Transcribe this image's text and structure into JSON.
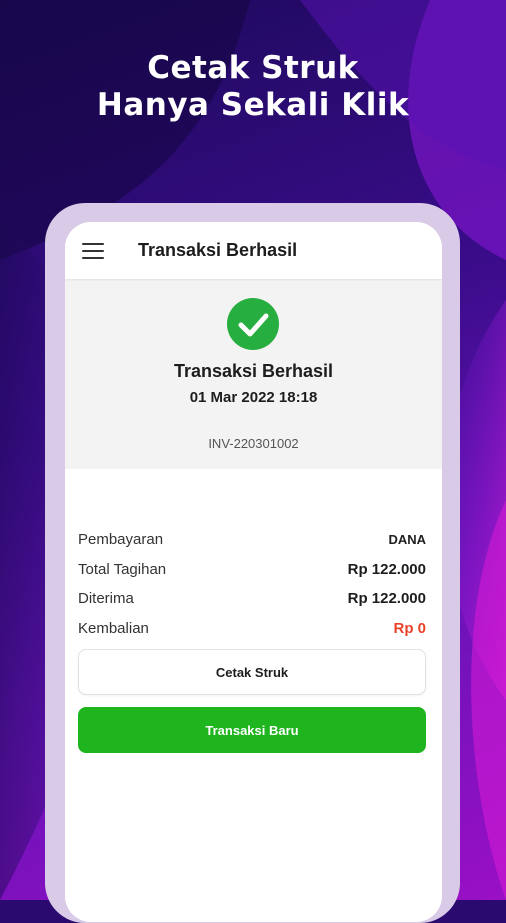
{
  "promo": {
    "line1": "Cetak Struk",
    "line2": "Hanya Sekali Klik"
  },
  "appbar": {
    "title": "Transaksi Berhasil",
    "menu_icon": "hamburger-menu-icon"
  },
  "hero": {
    "icon": "check-circle-icon",
    "title": "Transaksi Berhasil",
    "date": "01 Mar 2022 18:18",
    "invoice": "INV-220301002"
  },
  "details": [
    {
      "label": "Pembayaran",
      "value": "DANA"
    },
    {
      "label": "Total Tagihan",
      "value": "Rp 122.000"
    },
    {
      "label": "Diterima",
      "value": "Rp 122.000"
    },
    {
      "label": "Kembalian",
      "value": "Rp 0"
    }
  ],
  "buttons": {
    "print_label": "Cetak Struk",
    "new_label": "Transaksi Baru"
  },
  "colors": {
    "accent_green": "#1fb51f",
    "success_green": "#27ae40",
    "change_red": "#e8432a"
  }
}
